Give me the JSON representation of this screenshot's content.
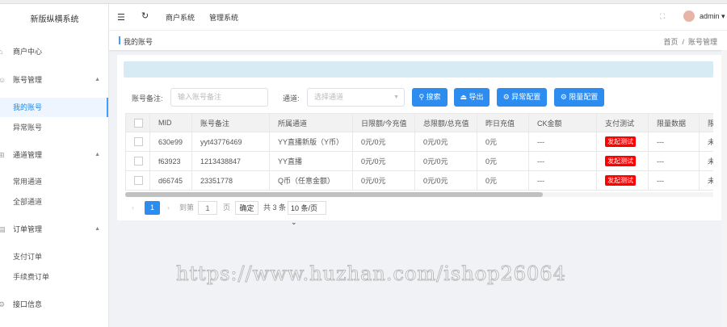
{
  "app": {
    "title": "新版纵横系统"
  },
  "header": {
    "tabs": [
      "商户系统",
      "管理系统"
    ],
    "user": "admin"
  },
  "breadcrumb": {
    "page": "我的账号",
    "home": "首页",
    "sep": "/",
    "current": "账号管理"
  },
  "sidebar": {
    "items": [
      {
        "label": "商户中心",
        "icon": "home-icon"
      },
      {
        "label": "账号管理",
        "icon": "user-icon",
        "expanded": true
      },
      {
        "label": "我的账号",
        "sub": true,
        "active": true
      },
      {
        "label": "异常账号",
        "sub": true
      },
      {
        "label": "通道管理",
        "icon": "grid-icon",
        "expanded": true
      },
      {
        "label": "常用通道",
        "sub": true
      },
      {
        "label": "全部通道",
        "sub": true
      },
      {
        "label": "订单管理",
        "icon": "order-icon",
        "expanded": true
      },
      {
        "label": "支付订单",
        "sub": true
      },
      {
        "label": "手续费订单",
        "sub": true
      },
      {
        "label": "接口信息",
        "icon": "gear-icon"
      }
    ]
  },
  "filters": {
    "remark_label": "账号备注:",
    "remark_placeholder": "输入账号备注",
    "channel_label": "通道:",
    "channel_placeholder": "选择通道"
  },
  "buttons": {
    "search": "搜索",
    "export": "导出",
    "abnormal": "异常配置",
    "limit": "限量配置"
  },
  "table": {
    "headers": [
      "MID",
      "账号备注",
      "所属通道",
      "日限额/今充值",
      "总限额/总充值",
      "昨日充值",
      "CK金额",
      "支付测试",
      "限量数据",
      "限"
    ],
    "rows": [
      [
        "630e99",
        "yyt43776469",
        "YY直播新版（Y币）",
        "0元/0元",
        "0元/0元",
        "0元",
        "---",
        "发起测试",
        "---",
        "未"
      ],
      [
        "f63923",
        "1213438847",
        "YY直播",
        "0元/0元",
        "0元/0元",
        "0元",
        "---",
        "发起测试",
        "---",
        "未"
      ],
      [
        "d66745",
        "23351778",
        "Q币（任意金额）",
        "0元/0元",
        "0元/0元",
        "0元",
        "---",
        "发起测试",
        "---",
        "未"
      ]
    ]
  },
  "pagination": {
    "current": "1",
    "goto": "到第",
    "page_input": "1",
    "page_unit": "页",
    "confirm": "确定",
    "total": "共 3 条",
    "page_size": "10 条/页"
  },
  "watermark": "https://www.huzhan.com/ishop26064",
  "colors": {
    "primary": "#2d8cf0",
    "danger": "#ff0000",
    "info": "#d7ebf4"
  }
}
